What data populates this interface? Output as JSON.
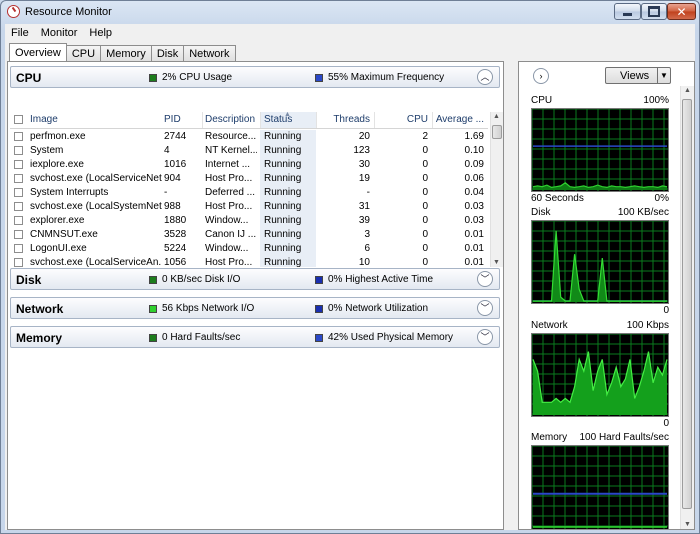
{
  "window": {
    "title": "Resource Monitor"
  },
  "menu": [
    "File",
    "Monitor",
    "Help"
  ],
  "tabs": [
    "Overview",
    "CPU",
    "Memory",
    "Disk",
    "Network"
  ],
  "sections": {
    "cpu": {
      "title": "CPU",
      "legend1": "2% CPU Usage",
      "legend1_color": "#1d7d1d",
      "legend2": "55% Maximum Frequency",
      "legend2_color": "#2a48c8"
    },
    "disk": {
      "title": "Disk",
      "legend1": "0 KB/sec Disk I/O",
      "legend1_color": "#1d7d1d",
      "legend2": "0% Highest Active Time",
      "legend2_color": "#1a2fb0"
    },
    "network": {
      "title": "Network",
      "legend1": "56 Kbps Network I/O",
      "legend1_color": "#2fd02f",
      "legend2": "0% Network Utilization",
      "legend2_color": "#1a2fb0"
    },
    "memory": {
      "title": "Memory",
      "legend1": "0 Hard Faults/sec",
      "legend1_color": "#1d7d1d",
      "legend2": "42% Used Physical Memory",
      "legend2_color": "#2a48c8"
    }
  },
  "cpu_table": {
    "columns": {
      "image": "Image",
      "pid": "PID",
      "description": "Description",
      "status": "Status",
      "threads": "Threads",
      "cpu": "CPU",
      "average": "Average ..."
    },
    "rows": [
      {
        "image": "perfmon.exe",
        "pid": "2744",
        "description": "Resource...",
        "status": "Running",
        "threads": "20",
        "cpu": "2",
        "average": "1.69"
      },
      {
        "image": "System",
        "pid": "4",
        "description": "NT Kernel...",
        "status": "Running",
        "threads": "123",
        "cpu": "0",
        "average": "0.10"
      },
      {
        "image": "iexplore.exe",
        "pid": "1016",
        "description": "Internet ...",
        "status": "Running",
        "threads": "30",
        "cpu": "0",
        "average": "0.09"
      },
      {
        "image": "svchost.exe (LocalServiceNet...",
        "pid": "904",
        "description": "Host Pro...",
        "status": "Running",
        "threads": "19",
        "cpu": "0",
        "average": "0.06"
      },
      {
        "image": "System Interrupts",
        "pid": "-",
        "description": "Deferred ...",
        "status": "Running",
        "threads": "-",
        "cpu": "0",
        "average": "0.04"
      },
      {
        "image": "svchost.exe (LocalSystemNet...",
        "pid": "988",
        "description": "Host Pro...",
        "status": "Running",
        "threads": "31",
        "cpu": "0",
        "average": "0.03"
      },
      {
        "image": "explorer.exe",
        "pid": "1880",
        "description": "Window...",
        "status": "Running",
        "threads": "39",
        "cpu": "0",
        "average": "0.03"
      },
      {
        "image": "CNMNSUT.exe",
        "pid": "3528",
        "description": "Canon IJ ...",
        "status": "Running",
        "threads": "3",
        "cpu": "0",
        "average": "0.01"
      },
      {
        "image": "LogonUI.exe",
        "pid": "5224",
        "description": "Window...",
        "status": "Running",
        "threads": "6",
        "cpu": "0",
        "average": "0.01"
      },
      {
        "image": "svchost.exe (LocalServiceAn...",
        "pid": "1056",
        "description": "Host Pro...",
        "status": "Running",
        "threads": "10",
        "cpu": "0",
        "average": "0.01"
      }
    ]
  },
  "right_panel": {
    "views_label": "Views",
    "graphs": [
      {
        "name": "CPU",
        "max_label": "100%",
        "bottom_left": "60 Seconds",
        "bottom_right": "0%"
      },
      {
        "name": "Disk",
        "max_label": "100 KB/sec",
        "bottom_left": "",
        "bottom_right": "0"
      },
      {
        "name": "Network",
        "max_label": "100 Kbps",
        "bottom_left": "",
        "bottom_right": "0"
      },
      {
        "name": "Memory",
        "max_label": "100 Hard Faults/sec",
        "bottom_left": "",
        "bottom_right": ""
      }
    ]
  },
  "series": {
    "cpu_usage": [
      3,
      4,
      3,
      5,
      2,
      3,
      4,
      8,
      3,
      2,
      3,
      4,
      2,
      3,
      5,
      3,
      2,
      4,
      3,
      3,
      2,
      3,
      4,
      3,
      2,
      3,
      3,
      2,
      4,
      3
    ],
    "cpu_freq": [
      55,
      55,
      55,
      55,
      55,
      55,
      55,
      55,
      55,
      55,
      55,
      55,
      55,
      55,
      55,
      55,
      55,
      55,
      55,
      55,
      55,
      55,
      55,
      55,
      55,
      55,
      55,
      55,
      55,
      55
    ],
    "disk_io": [
      0,
      0,
      0,
      0,
      0,
      90,
      5,
      0,
      0,
      60,
      15,
      0,
      0,
      0,
      0,
      55,
      0,
      0,
      0,
      0,
      0,
      0,
      0,
      0,
      0,
      0,
      0,
      0,
      0,
      0
    ],
    "disk_active": [
      0,
      0,
      0,
      0,
      0,
      0,
      0,
      0,
      0,
      0,
      0,
      0,
      0,
      0,
      0,
      0,
      0,
      0,
      0,
      0,
      0,
      0,
      0,
      0,
      0,
      0,
      0,
      0,
      0,
      0
    ],
    "net_io": [
      70,
      55,
      15,
      15,
      15,
      20,
      15,
      20,
      15,
      35,
      70,
      55,
      80,
      30,
      55,
      70,
      25,
      40,
      60,
      35,
      45,
      70,
      20,
      35,
      55,
      80,
      40,
      60,
      50,
      70
    ],
    "net_util": [
      0,
      0,
      0,
      0,
      0,
      0,
      0,
      0,
      0,
      0,
      0,
      0,
      0,
      0,
      0,
      0,
      0,
      0,
      0,
      0,
      0,
      0,
      0,
      0,
      0,
      0,
      0,
      0,
      0,
      0
    ],
    "mem_faults": [
      0,
      0,
      0,
      0,
      0,
      0,
      0,
      0,
      0,
      0,
      0,
      0,
      0,
      0,
      0,
      0,
      0,
      0,
      0,
      0,
      0,
      0,
      0,
      0,
      0,
      0,
      0,
      0,
      0,
      0
    ],
    "mem_used": [
      42,
      42,
      42,
      42,
      42,
      42,
      42,
      42,
      42,
      42,
      42,
      42,
      42,
      42,
      42,
      42,
      42,
      42,
      42,
      42,
      42,
      42,
      42,
      42,
      42,
      42,
      42,
      42,
      42,
      42
    ]
  }
}
